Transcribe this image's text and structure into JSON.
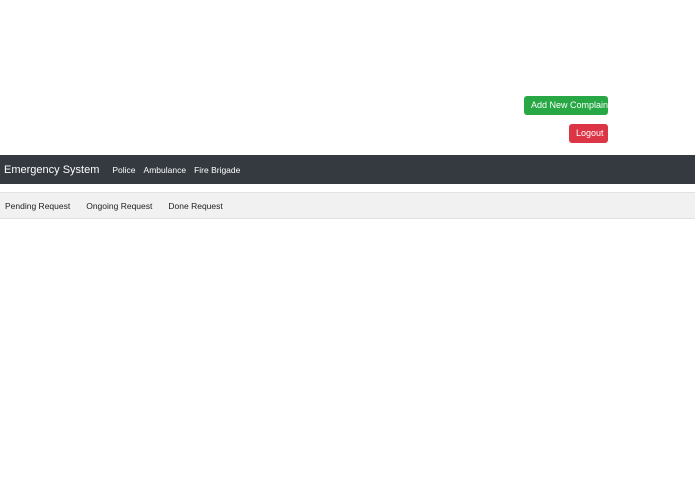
{
  "actions": {
    "add_complain_label": "Add New Complain",
    "logout_label": "Logout"
  },
  "navbar": {
    "brand": "Emergency System",
    "links": [
      "Police",
      "Ambulance",
      "Fire Brigade"
    ]
  },
  "tabs": [
    "Pending Request",
    "Ongoing Request",
    "Done Request"
  ],
  "colors": {
    "add_button": "#28a745",
    "logout_button": "#dc3545",
    "navbar": "#343a40",
    "subnav": "#f1f1f1"
  }
}
